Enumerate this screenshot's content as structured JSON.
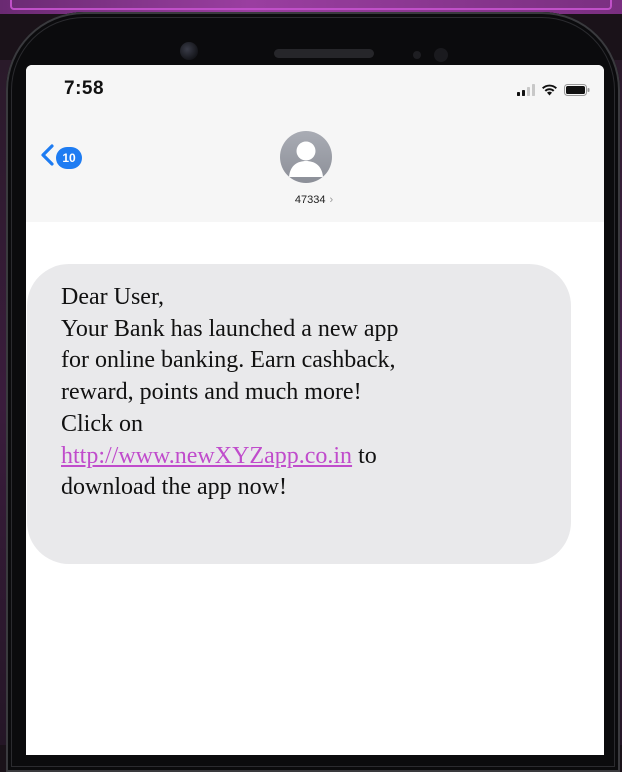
{
  "status_bar": {
    "time": "7:58",
    "icons": [
      "signal-bars-icon",
      "wifi-icon",
      "battery-icon"
    ]
  },
  "nav": {
    "back_icon": "chevron-left-icon",
    "unread_count": "10"
  },
  "contact": {
    "avatar_icon": "person-silhouette-icon",
    "name": "47334",
    "chevron": "›"
  },
  "message": {
    "greeting": "Dear User,",
    "line1": "Your Bank has launched a new app",
    "line2": "for online banking. Earn cashback,",
    "line3": "reward, points and much more!",
    "line4": "Click on",
    "link": "http://www.newXYZapp.co.in",
    "link_suffix": " to",
    "line6": "download the app now!"
  },
  "colors": {
    "accent_blue": "#1e7cf2",
    "link_purple": "#c04ccc",
    "bubble_gray": "#e9e9eb"
  }
}
